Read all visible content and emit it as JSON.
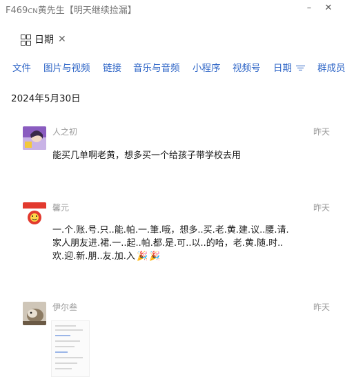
{
  "window": {
    "title_prefix": "F469",
    "title_small": "CN",
    "title_rest": "黄先生【明天继续捡漏】",
    "minimize_symbol": "–",
    "close_symbol": "✕"
  },
  "filter": {
    "label": "日期",
    "icon": "grid-icon",
    "clear_symbol": "✕"
  },
  "tabs": [
    {
      "label": "文件"
    },
    {
      "label": "图片与视频"
    },
    {
      "label": "链接"
    },
    {
      "label": "音乐与音频"
    },
    {
      "label": "小程序"
    },
    {
      "label": "视频号"
    },
    {
      "label": "日期",
      "icon": "filter-icon"
    },
    {
      "label": "群成员"
    }
  ],
  "date_header": "2024年5月30日",
  "messages": [
    {
      "sender": "人之初",
      "time": "昨天",
      "text": "能买几单啊老黄，想多买一个给孩子带学校去用"
    },
    {
      "sender": "馨元",
      "time": "昨天",
      "line1": "一.个.账.号.只..能.帕.一.筆.哦，想多..买.老.黄.建.议..腰.请.",
      "line2": "家人朋友进.裙.一..起..帕.都.是.可..以..的哈，老.黄.随.时..",
      "line3": "欢.迎.新.朋..友.加.入",
      "emojis": [
        "🎉",
        "🎉"
      ]
    },
    {
      "sender": "伊尔叁",
      "time": "昨天",
      "attachment": "image"
    }
  ],
  "colors": {
    "tab_text": "#2b63c6",
    "meta_text": "#9a9a9a",
    "body_text": "#1a1a1a"
  }
}
